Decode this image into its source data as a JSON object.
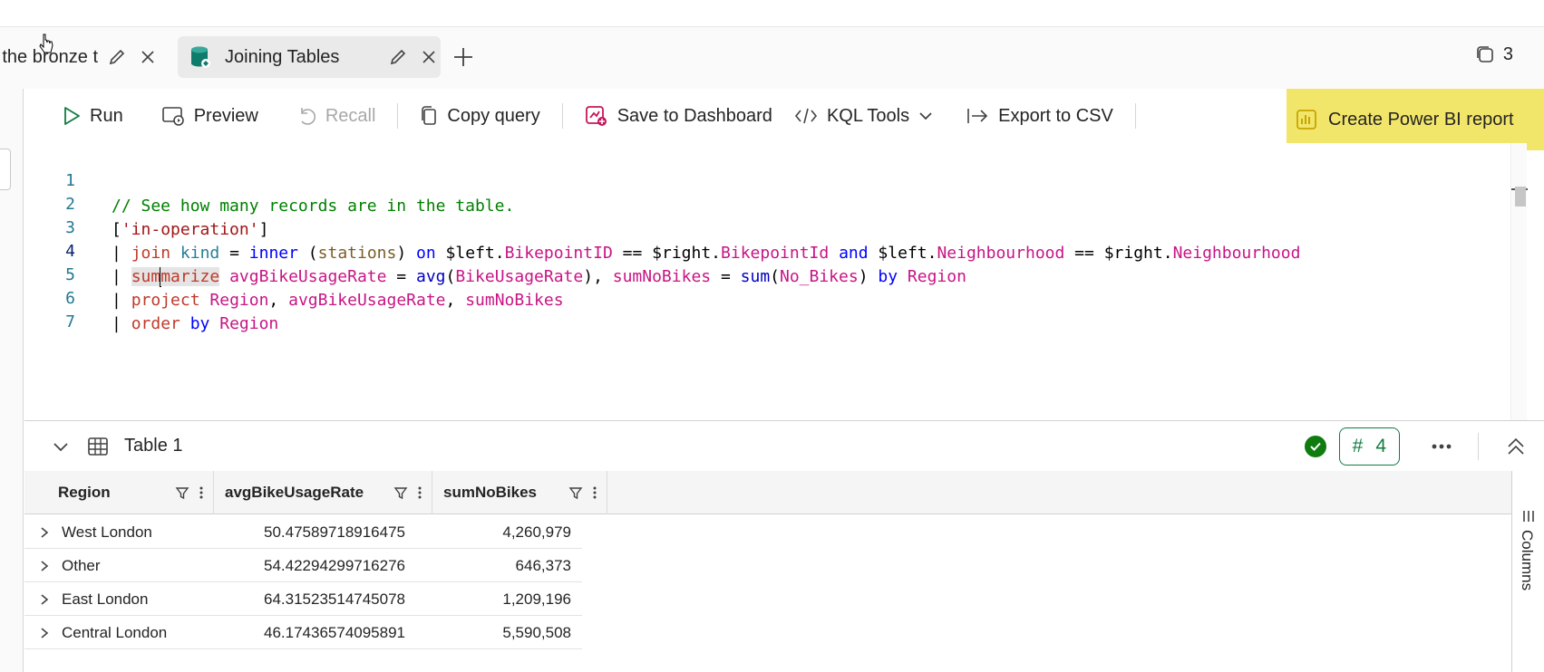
{
  "tabs": [
    {
      "label": "Ingest into the bronze t..."
    },
    {
      "label": "Joining Tables"
    }
  ],
  "tab_count": "3",
  "toolbar": {
    "run": "Run",
    "preview": "Preview",
    "recall": "Recall",
    "copy_query": "Copy query",
    "save_to_dashboard": "Save to Dashboard",
    "kql_tools": "KQL Tools",
    "export_csv": "Export to CSV",
    "create_pbi": "Create Power BI report"
  },
  "editor": {
    "line_numbers": [
      "1",
      "2",
      "3",
      "4",
      "5",
      "6",
      "7"
    ],
    "l1": "// See how many records are in the table.",
    "l2_open": "[",
    "l2_str": "'in-operation'",
    "l2_close": "]",
    "pipe": "| ",
    "join": "join",
    "kind": "kind",
    "eq": " = ",
    "inner": "inner",
    "stations_open": " (",
    "stations": "stations",
    "stations_close": ") ",
    "on": "on",
    "left_a": " $left.",
    "bikepointid": "BikepointID",
    "deq": " == ",
    "right_a": "$right.",
    "bikepointid2": "BikepointId",
    "and": "and",
    "left_b": " $left.",
    "neighbourhood": "Neighbourhood",
    "right_b": "$right.",
    "neighbourhood2": "Neighbourhood",
    "sum_pre": "sum",
    "sum_post": "marize",
    "avg_name": "avgBikeUsageRate",
    "avg_fn": "avg",
    "paren_open": "(",
    "bike_usage": "BikeUsageRate",
    "paren_close_comma": "), ",
    "sum_name": "sumNoBikes",
    "sum_fn": "sum",
    "no_bikes": "No_Bikes",
    "paren_close": ") ",
    "by": "by",
    "region": "Region",
    "project": "project",
    "comma": ", ",
    "order": "order"
  },
  "results": {
    "title": "Table 1",
    "row_count": "4",
    "columns": [
      "Region",
      "avgBikeUsageRate",
      "sumNoBikes"
    ],
    "rows": [
      {
        "region": "West London",
        "avg": "50.47589718916475",
        "sum": "4,260,979"
      },
      {
        "region": "Other",
        "avg": "54.42294299716276",
        "sum": "646,373"
      },
      {
        "region": "East London",
        "avg": "64.31523514745078",
        "sum": "1,209,196"
      },
      {
        "region": "Central London",
        "avg": "46.17436574095891",
        "sum": "5,590,508"
      }
    ],
    "columns_panel_label": "Columns"
  },
  "colors": {
    "accent_green": "#107c41",
    "highlight_yellow": "#f2e66a",
    "comment_green": "#008000"
  }
}
